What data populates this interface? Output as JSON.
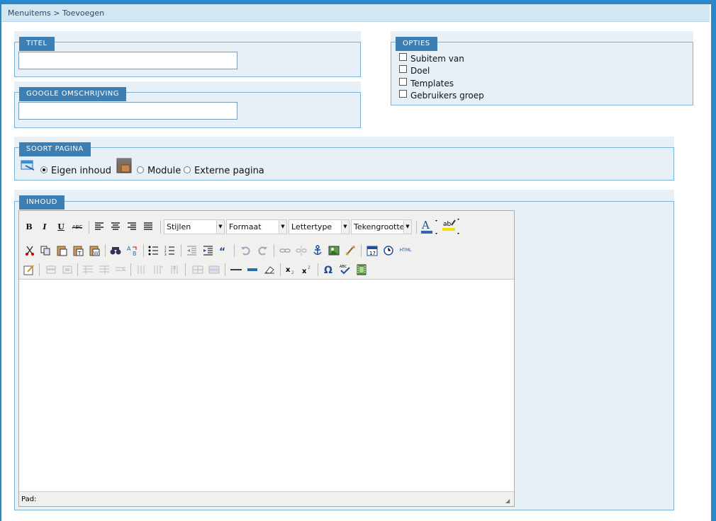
{
  "breadcrumb": "Menuitems > Toevoegen",
  "titel": {
    "legend": "TITEL",
    "value": ""
  },
  "google": {
    "legend": "GOOGLE OMSCHRIJVING",
    "value": ""
  },
  "opties": {
    "legend": "OPTIES",
    "items": [
      "Subitem van",
      "Doel",
      "Templates",
      "Gebruikers groep"
    ]
  },
  "soort": {
    "legend": "SOORT PAGINA",
    "options": [
      "Eigen inhoud",
      "Module",
      "Externe pagina"
    ],
    "selected": "Eigen inhoud"
  },
  "inhoud": {
    "legend": "INHOUD"
  },
  "editor": {
    "row1": {
      "bold": "B",
      "italic": "I",
      "underline": "U",
      "strike": "ABC"
    },
    "dropdowns": [
      "Stijlen",
      "Formaat",
      "Lettertype",
      "Tekengrootte"
    ],
    "status_label": "Pad:",
    "html_label": "HTML"
  },
  "colors": {
    "accent": "#3d7fb3",
    "panel": "#e8f0f7",
    "border": "#7db2d6"
  }
}
